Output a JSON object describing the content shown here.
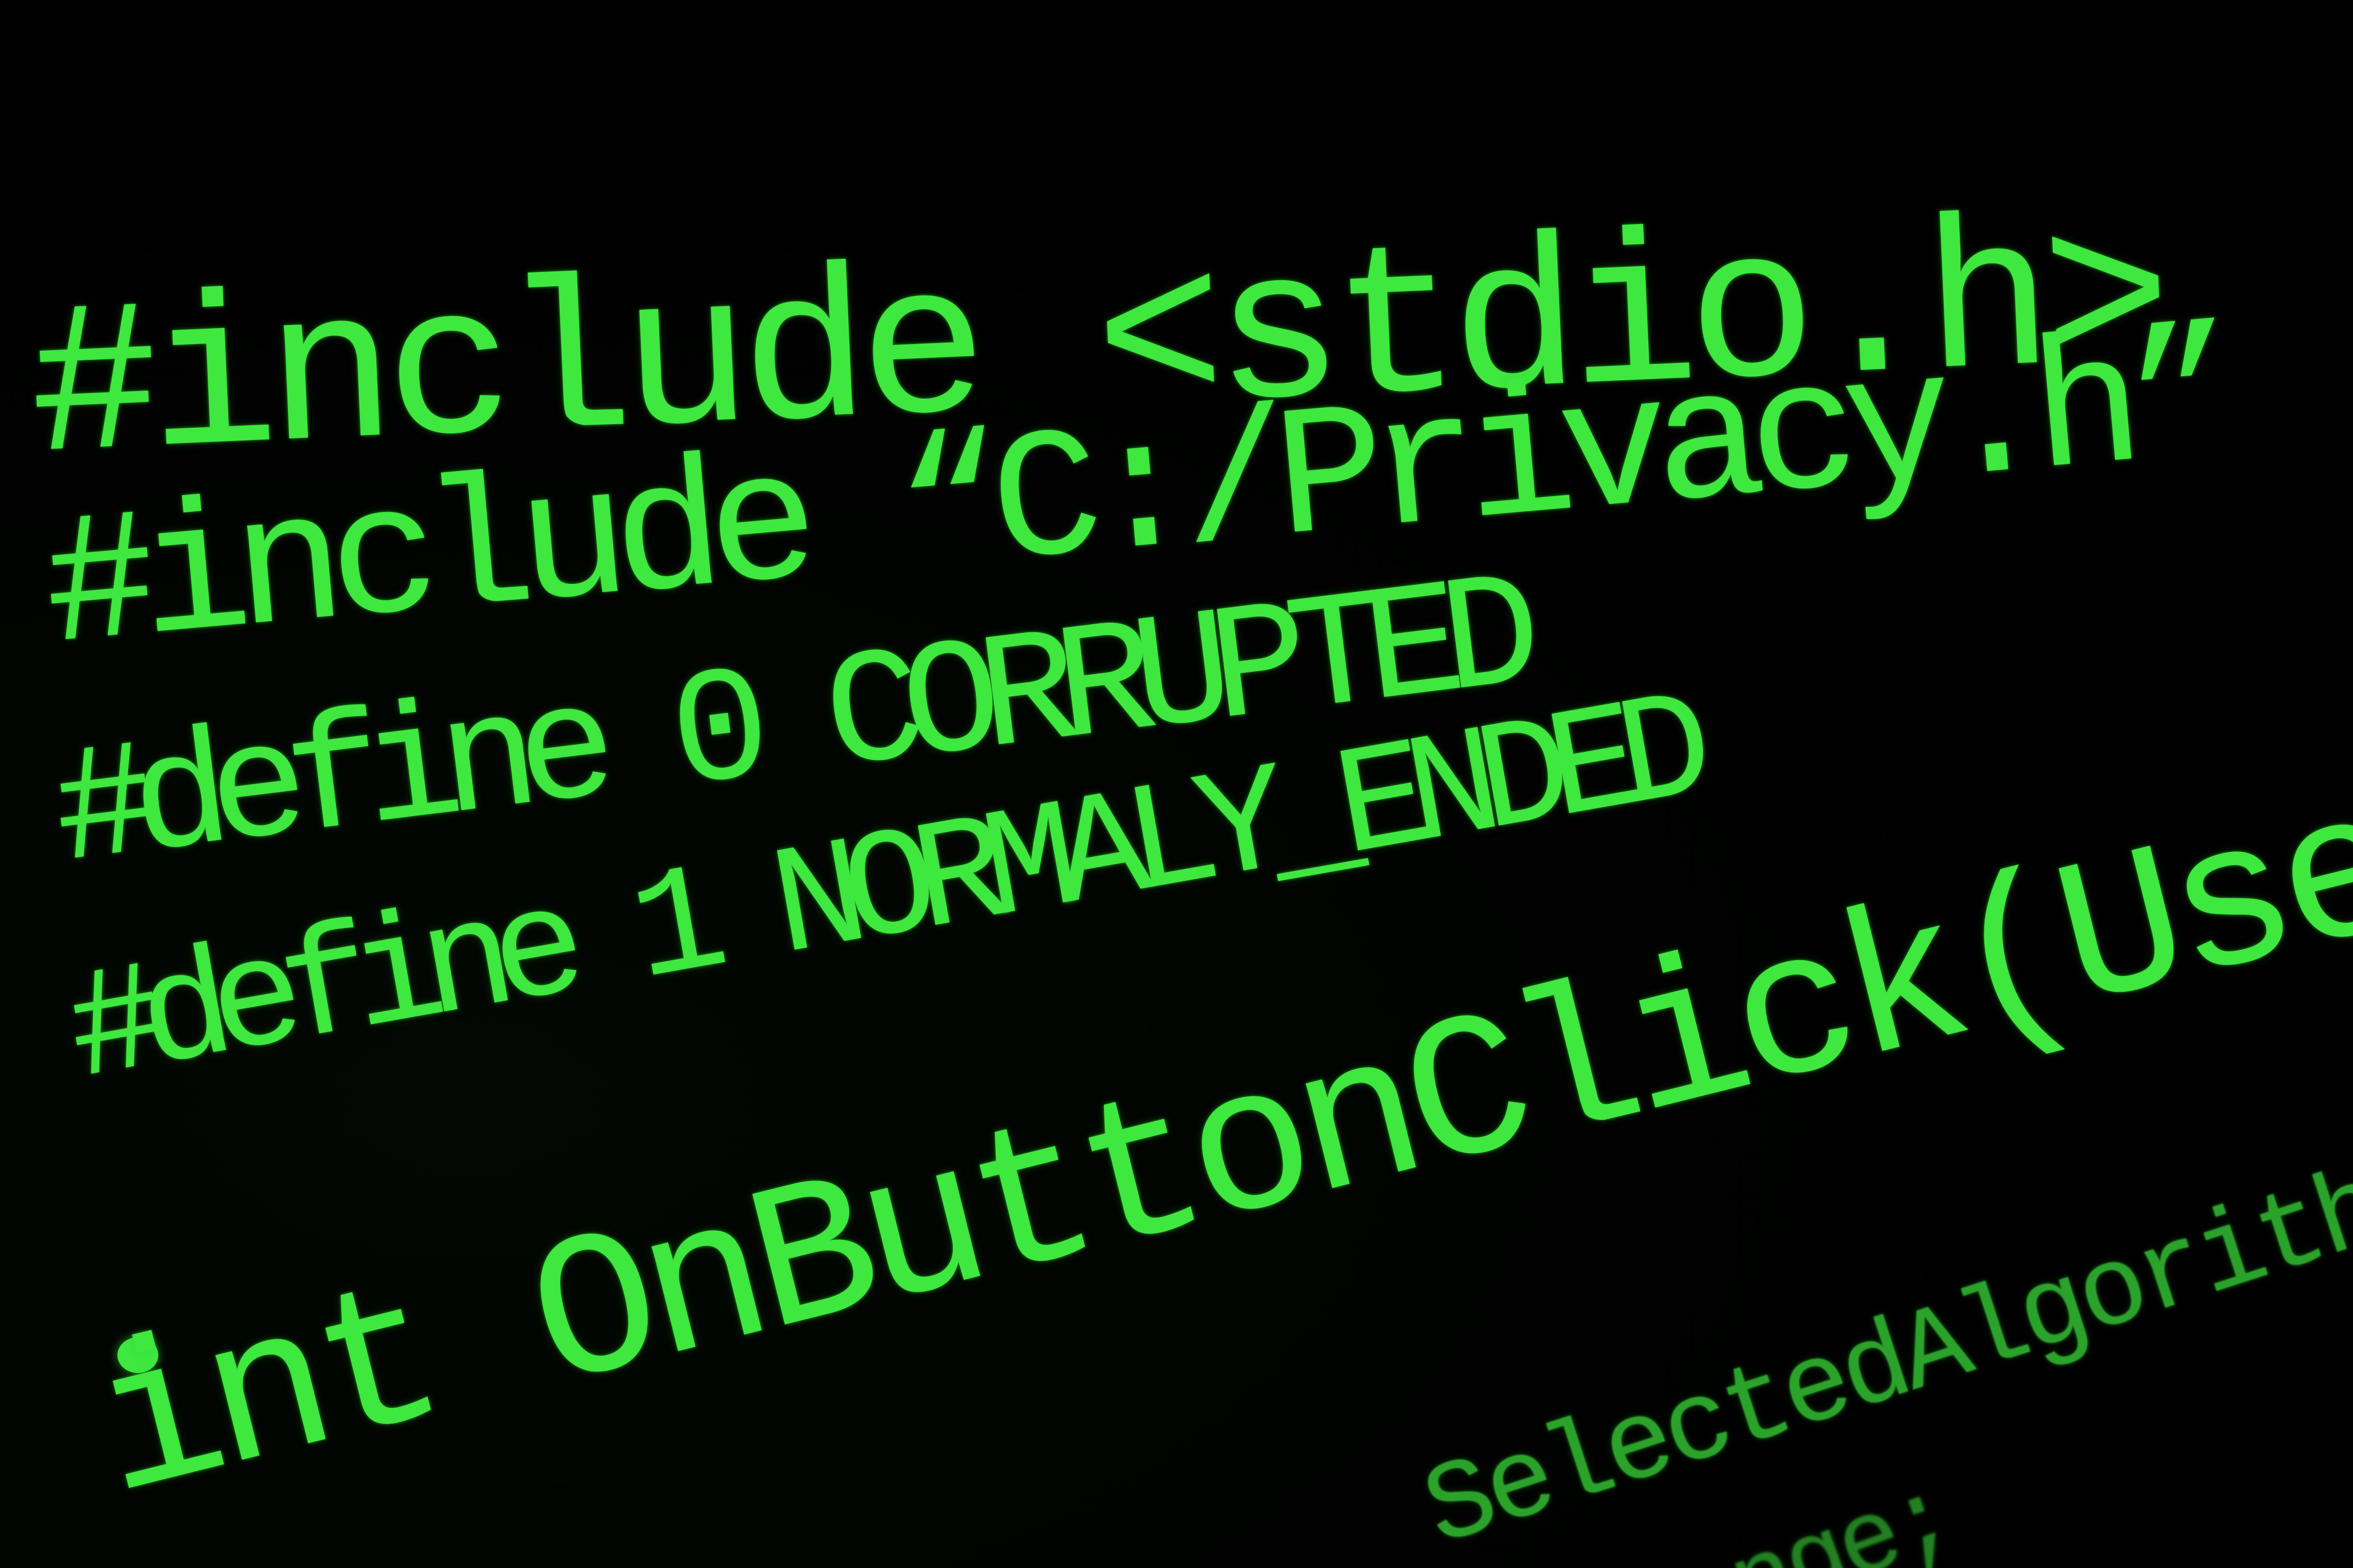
{
  "editor": {
    "lines": [
      "#include <stdio.h>",
      "#include “C:/Privacy.h”",
      "#define 0 CORRUPTED",
      "#define 1 NORMALY_ENDED",
      "int OnButtonClick(UserID,*Selecte",
      "SelectedAlgorithm,",
      "nge;"
    ],
    "bullet": "•"
  },
  "colors": {
    "background": "#000000",
    "text": "#3ee83e"
  }
}
